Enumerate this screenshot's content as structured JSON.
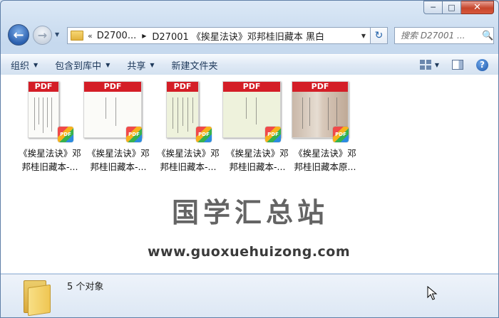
{
  "window": {
    "caption_min": "─",
    "caption_max": "□",
    "caption_close": "✕"
  },
  "nav": {
    "back_icon": "←",
    "forward_icon": "→",
    "address_overflow": "«",
    "address_segment_1": "D2700...",
    "address_segment_2": "D27001 《挨星法诀》邓邦桂旧藏本 黑白",
    "refresh_icon": "↻",
    "search_placeholder": "搜索 D27001 ...",
    "search_icon": "🔍"
  },
  "commands": {
    "organize": "组织",
    "include_in_library": "包含到库中",
    "share": "共享",
    "new_folder": "新建文件夹",
    "help": "?"
  },
  "files": [
    {
      "line1": "《挨星法诀》邓",
      "line2": "邦桂旧藏本-...",
      "thumb_label": "PDF",
      "badge": "PDF"
    },
    {
      "line1": "《挨星法诀》邓",
      "line2": "邦桂旧藏本-...",
      "thumb_label": "PDF",
      "badge": "PDF"
    },
    {
      "line1": "《挨星法诀》邓",
      "line2": "邦桂旧藏本-...",
      "thumb_label": "PDF",
      "badge": "PDF"
    },
    {
      "line1": "《挨星法诀》邓",
      "line2": "邦桂旧藏本-...",
      "thumb_label": "PDF",
      "badge": "PDF"
    },
    {
      "line1": "《挨星法诀》邓",
      "line2": "邦桂旧藏本原...",
      "thumb_label": "PDF",
      "badge": "PDF"
    }
  ],
  "watermark": {
    "title": "国学汇总站",
    "url": "www.guoxuehuizong.com"
  },
  "status": {
    "item_count": "5 个对象"
  }
}
